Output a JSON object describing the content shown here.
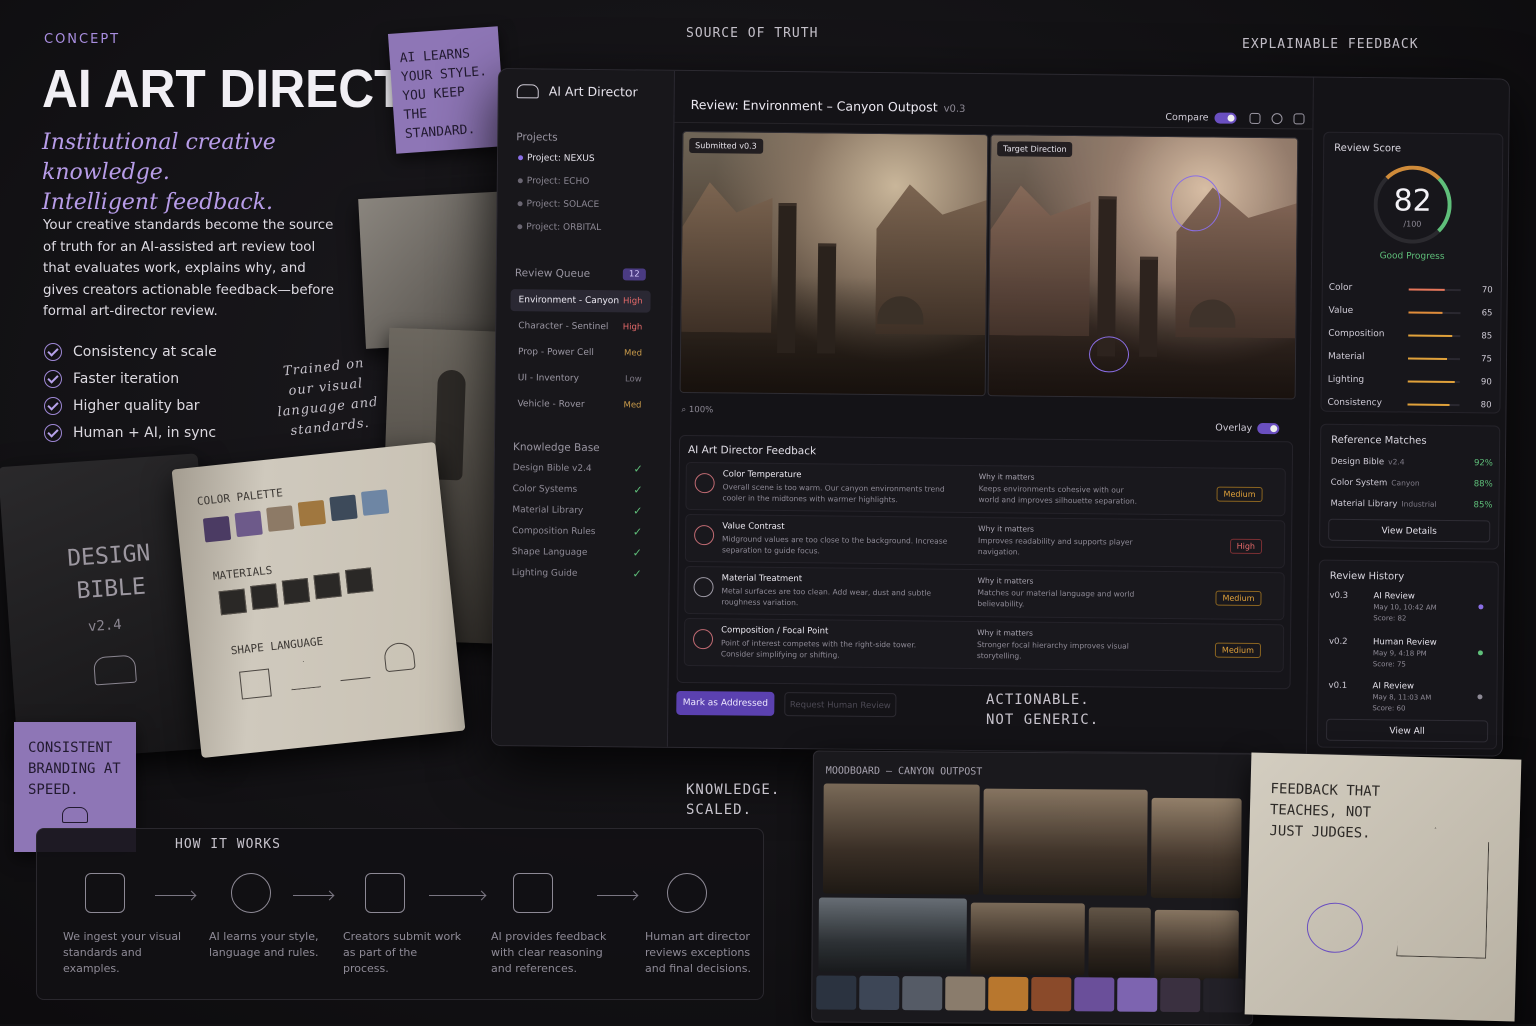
{
  "hero": {
    "eyebrow": "CONCEPT",
    "title": "AI ART DIRECTOR",
    "tagline_1": "Institutional creative knowledge.",
    "tagline_2": "Intelligent feedback.",
    "lead": "Your creative standards become the source of truth for an AI-assisted art review tool that evaluates work, explains why, and gives creators actionable feedback—before formal art-director review.",
    "checks": [
      "Consistency at scale",
      "Faster iteration",
      "Higher quality bar",
      "Human + AI, in sync"
    ]
  },
  "notes": {
    "sticky_top": "AI LEARNS YOUR STYLE. YOU KEEP THE STANDARD.",
    "sticky_bottom": "CONSISTENT BRANDING AT SPEED.",
    "trained": "Trained on our visual language and standards.",
    "source_of_truth": "SOURCE OF TRUTH",
    "explainable": "EXPLAINABLE FEEDBACK",
    "actionable": "ACTIONABLE. NOT GENERIC.",
    "knowledge": "KNOWLEDGE. SCALED.",
    "teaches": "FEEDBACK THAT TEACHES, NOT JUST JUDGES."
  },
  "book": {
    "cover_line1": "DESIGN",
    "cover_line2": "BIBLE",
    "version": "v2.4",
    "h_palette": "COLOR PALETTE",
    "h_materials": "MATERIALS",
    "h_shape": "SHAPE LANGUAGE",
    "palette": [
      "#4b3b63",
      "#6d5a8a",
      "#8d7a66",
      "#a0773f",
      "#3d4a5a",
      "#6e86a4"
    ]
  },
  "app": {
    "name": "AI Art Director",
    "projects_label": "Projects",
    "projects": [
      "Project: NEXUS",
      "Project: ECHO",
      "Project: SOLACE",
      "Project: ORBITAL"
    ],
    "queue_label": "Review Queue",
    "queue_count": "12",
    "queue": [
      {
        "name": "Environment - Canyon",
        "priority": "High"
      },
      {
        "name": "Character - Sentinel",
        "priority": "High"
      },
      {
        "name": "Prop - Power Cell",
        "priority": "Med"
      },
      {
        "name": "UI - Inventory",
        "priority": "Low"
      },
      {
        "name": "Vehicle - Rover",
        "priority": "Med"
      }
    ],
    "kb_label": "Knowledge Base",
    "kb": [
      "Design Bible v2.4",
      "Color Systems",
      "Material Library",
      "Composition Rules",
      "Shape Language",
      "Lighting Guide"
    ],
    "review_title": "Review: Environment – Canyon Outpost",
    "review_version": "v0.3",
    "compare_label": "Compare",
    "submitted_label": "Submitted v0.3",
    "target_label": "Target Direction",
    "zoom": "100%",
    "overlay_label": "Overlay",
    "feedback_title": "AI Art Director Feedback",
    "why_label": "Why it matters",
    "feedback": [
      {
        "title": "Color Temperature",
        "desc": "Overall scene is too warm. Our canyon environments trend cooler in the midtones with warmer highlights.",
        "why": "Keeps environments cohesive with our world and improves silhouette separation.",
        "severity": "Medium"
      },
      {
        "title": "Value Contrast",
        "desc": "Midground values are too close to the background. Increase separation to guide focus.",
        "why": "Improves readability and supports player navigation.",
        "severity": "High"
      },
      {
        "title": "Material Treatment",
        "desc": "Metal surfaces are too clean. Add wear, dust and subtle roughness variation.",
        "why": "Matches our material language and world believability.",
        "severity": "Medium"
      },
      {
        "title": "Composition / Focal Point",
        "desc": "Point of interest competes with the right-side tower. Consider simplifying or shifting.",
        "why": "Stronger focal hierarchy improves visual storytelling.",
        "severity": "Medium"
      }
    ],
    "btn_addressed": "Mark as Addressed",
    "btn_human": "Request Human Review",
    "score": {
      "label": "Review Score",
      "value": "82",
      "denom": "/100",
      "status": "Good Progress",
      "metrics": [
        {
          "name": "Color",
          "value": 70
        },
        {
          "name": "Value",
          "value": 65
        },
        {
          "name": "Composition",
          "value": 85
        },
        {
          "name": "Material",
          "value": 75
        },
        {
          "name": "Lighting",
          "value": 90
        },
        {
          "name": "Consistency",
          "value": 80
        }
      ]
    },
    "refs": {
      "label": "Reference Matches",
      "items": [
        {
          "name": "Design Bible",
          "sub": "v2.4",
          "pct": "92%"
        },
        {
          "name": "Color System",
          "sub": "Canyon",
          "pct": "88%"
        },
        {
          "name": "Material Library",
          "sub": "Industrial",
          "pct": "85%"
        }
      ],
      "button": "View Details"
    },
    "history": {
      "label": "Review History",
      "items": [
        {
          "ver": "v0.3",
          "name": "AI Review",
          "date": "May 10, 10:42 AM",
          "score": "Score: 82",
          "color": "#8a6ee6"
        },
        {
          "ver": "v0.2",
          "name": "Human Review",
          "date": "May 9, 4:18 PM",
          "score": "Score: 75",
          "color": "#5fbf7a"
        },
        {
          "ver": "v0.1",
          "name": "AI Review",
          "date": "May 8, 11:03 AM",
          "score": "Score: 60",
          "color": "#8e8a96"
        }
      ],
      "button": "View All"
    }
  },
  "how": {
    "title": "HOW IT WORKS",
    "steps": [
      {
        "icon": "book-icon",
        "text": "We ingest your visual standards and examples."
      },
      {
        "icon": "network-icon",
        "text": "AI learns your style, language and rules."
      },
      {
        "icon": "upload-icon",
        "text": "Creators submit work as part of the process."
      },
      {
        "icon": "chat-icon",
        "text": "AI provides feedback with clear reasoning and references."
      },
      {
        "icon": "person-icon",
        "text": "Human art director reviews exceptions and final decisions."
      }
    ]
  },
  "moodboard": {
    "title": "MOODBOARD – CANYON OUTPOST",
    "swatches": [
      "#2b3340",
      "#3d4656",
      "#555b66",
      "#8a7c6c",
      "#b8772e",
      "#8a4a2a",
      "#6a4f9a",
      "#7d64b0",
      "#3a3040",
      "#232128"
    ]
  },
  "colors": {
    "accent": "#6a4fc0",
    "medium": "#e0a13a",
    "high": "#e66a6a",
    "good": "#5fbf7a"
  }
}
